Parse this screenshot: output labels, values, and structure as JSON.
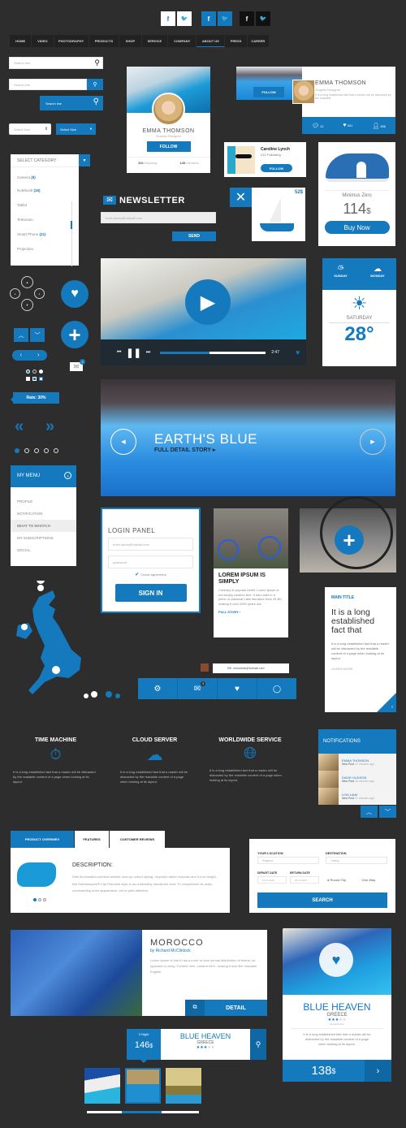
{
  "colors": {
    "accent": "#1479bd",
    "background": "#2d2d2d"
  },
  "social": [
    {
      "icon": "facebook-icon",
      "glyph": "f"
    },
    {
      "icon": "twitter-icon",
      "glyph": "t"
    }
  ],
  "nav": {
    "items": [
      "HOME",
      "VIDEO",
      "PHOTOGRAPHY",
      "PRODUCTS",
      "SHOP",
      "SERVICE",
      "COMPANY",
      "ABOUT US",
      "PRESS",
      "CAREER"
    ],
    "active": "ABOUT US"
  },
  "search": {
    "placeholder": "Search line"
  },
  "select": {
    "value": "Select Size"
  },
  "category": {
    "title": "SELECT CATEGORY",
    "items": [
      {
        "label": "Camera",
        "count": "(9)"
      },
      {
        "label": "Notebook",
        "count": "(16)"
      },
      {
        "label": "Tablet",
        "count": ""
      },
      {
        "label": "Television",
        "count": ""
      },
      {
        "label": "Smart Phone",
        "count": "(21)"
      },
      {
        "label": "Projection",
        "count": ""
      }
    ]
  },
  "profile": {
    "name": "EMMA THOMSON",
    "role": "Graphic Designer",
    "follow": "FOLLOW",
    "following_count": "332",
    "following_label": "following",
    "followers_count": "145",
    "followers_label": "followers"
  },
  "profile_wide": {
    "name": "EMMA THOMSON",
    "role": "Graphic Designer",
    "bio": "It is a long established fact that a reader will be distracted by the readable",
    "follow": "FOLLOW",
    "comments": "12",
    "likes": "341",
    "followers": "456"
  },
  "caroline": {
    "name": "Caroline Lynch",
    "following": "210 Following",
    "follow": "FOLLOW"
  },
  "shoe": {
    "name": "Minimus Zero",
    "price": "114",
    "currency": "$",
    "buy": "Buy Now"
  },
  "newsletter": {
    "title": "NEWSLETTER",
    "email": "enes.danis@hotmail.com",
    "send": "SEND"
  },
  "boat": {
    "price": "52$"
  },
  "video": {
    "time": "2:47",
    "progress": 0.47
  },
  "weather": {
    "days": [
      "SUNDAY",
      "MONDAY"
    ],
    "today": "SATURDAY",
    "temp": "28°"
  },
  "rate": {
    "label": "Rate: 30%"
  },
  "mail_badge": "3",
  "slider": {
    "title": "EARTH'S BLUE",
    "link": "FULL DETAIL STORY ▸",
    "pages": 5,
    "active": 1
  },
  "menu": {
    "title": "MY MENU",
    "items": [
      "PROFILE",
      "NOTIFICATION",
      "WHAT TO WHATCH",
      "MY SUBSCRIPTIONS",
      "SOCIAL"
    ],
    "active": "WHAT TO WHATCH"
  },
  "login": {
    "title": "LOGIN PANEL",
    "email_placeholder": "enes.danis@hotmail.com",
    "password_placeholder": "password",
    "agreement": "Check agreement",
    "submit": "SIGN IN"
  },
  "article": {
    "title": "LOREM IPSUM IS SIMPLY",
    "body": "Contrary to popular belief, Lorem Ipsum is not simply random text. It has roots in a piece of classical Latin literature from 45 BC, making it over 2000 years old.",
    "link": "FULL STORY ›"
  },
  "main_card": {
    "title": "MAIN TITLE",
    "lead": "It is a long established fact that",
    "body": "It is a long established fact that a reader will be distracted by the readable content of a page when looking at its layout.",
    "link": "LEARN MORE"
  },
  "toolbar": {
    "tooltip_me": "ME:",
    "tooltip_email": "enesdanis@hotmail.com",
    "mail_badge": "3"
  },
  "features": [
    {
      "title": "TIME MACHINE",
      "icon": "stopwatch-icon",
      "text": "It is a long established fact that a reader will be distracted by the readable content of a page when looking at its layout."
    },
    {
      "title": "CLOUD SERVER",
      "icon": "cloud-icon",
      "text": "It is a long established fact that a reader will be distracted by the readable content of a page when looking at its layout."
    },
    {
      "title": "WORLDWIDE SERVICE",
      "icon": "globe-icon",
      "text": "It is a long established fact that a reader will be distracted by the readable content of a page when looking at its layout."
    }
  ],
  "notifications": {
    "title": "NOTIFICATIONS",
    "items": [
      {
        "name": "EMMA THOMSON",
        "type": "New Post",
        "time": "12 minutes ago"
      },
      {
        "name": "DAVID HUDSON",
        "type": "New Post",
        "time": "18 minutes ago"
      },
      {
        "name": "LISA LIAM",
        "type": "New Post",
        "time": "21 minutes ago"
      }
    ]
  },
  "product": {
    "tabs": [
      "PRODUCT OVERWIEV",
      "FEATURES",
      "CUSTOMER REVIEWS"
    ],
    "heading": "DESCRIPTION:",
    "body": "With its beautiful premium leather, lace-up oxford styling, recycled rubber outsoles and 9-inch height, this Earthkeepers® City Premium style is an undeniably handsome boot. To complement its rustic, commanding outer appearance, we've paid attention."
  },
  "flight": {
    "location_label": "YOUR LOCATION",
    "location": "England",
    "destination_label": "DESTINATION",
    "destination": "Turkey",
    "depart_label": "DEPART DATE",
    "depart": "16.01.2013",
    "return_label": "RETURN DATE",
    "return": "24.01.2013",
    "round": "Round-Trip",
    "oneway": "One-Way",
    "search": "SEARCH"
  },
  "morocco": {
    "title": "MOROCCO",
    "author": "by Richard McClintock",
    "body": "Lorem Ipsum is that it has a more-or-less normal distribution of letters, as opposed to using 'Content here, content here', making it look like readable English.",
    "detail": "DETAIL"
  },
  "heaven": {
    "title": "BLUE HEAVEN",
    "country": "GREECE",
    "rating": 3,
    "rating_max": 5,
    "rating_caption": "Guest Review",
    "body": "It is a long established fact that a reader will be distracted by the readable content of a page when looking at its layout.",
    "price": "138",
    "currency": "$"
  },
  "booking": {
    "nights": "3 Night",
    "price": "146",
    "currency": "$",
    "title": "BLUE HEAVEN",
    "country": "GREECE",
    "rating": 3
  }
}
